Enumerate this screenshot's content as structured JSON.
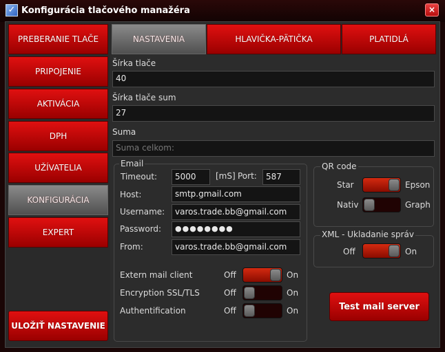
{
  "window": {
    "title": "Konfigurácia tlačového manažéra",
    "close": "×"
  },
  "sidebar": {
    "items": [
      {
        "label": "PREBERANIE TLAČE"
      },
      {
        "label": "PRIPOJENIE"
      },
      {
        "label": "AKTIVÁCIA"
      },
      {
        "label": "DPH"
      },
      {
        "label": "UŽÍVATELIA"
      },
      {
        "label": "KONFIGURÁCIA",
        "active": true
      },
      {
        "label": "EXPERT"
      }
    ],
    "save": "ULOŽIŤ NASTAVENIE"
  },
  "tabs": [
    {
      "label": "NASTAVENIA",
      "active": true
    },
    {
      "label": "HLAVIČKA-PÄTIČKA"
    },
    {
      "label": "PLATIDLÁ"
    }
  ],
  "fields": {
    "print_width_label": "Šírka tlače",
    "print_width": "40",
    "sum_width_label": "Šírka tlače sum",
    "sum_width": "27",
    "suma_label": "Suma",
    "suma_placeholder": "Suma celkom:"
  },
  "email": {
    "legend": "Email",
    "timeout_label": "Timeout:",
    "timeout": "5000",
    "unit": "[mS]",
    "port_label": "Port:",
    "port": "587",
    "host_label": "Host:",
    "host": "smtp.gmail.com",
    "username_label": "Username:",
    "username": "varos.trade.bb@gmail.com",
    "password_label": "Password:",
    "password": "●●●●●●●●",
    "from_label": "From:",
    "from": "varos.trade.bb@gmail.com",
    "toggles": [
      {
        "label": "Extern mail client",
        "off": "Off",
        "on": "On",
        "value": true
      },
      {
        "label": "Encryption SSL/TLS",
        "off": "Off",
        "on": "On",
        "value": false
      },
      {
        "label": "Authentification",
        "off": "Off",
        "on": "On",
        "value": false
      }
    ]
  },
  "qr": {
    "legend": "QR code",
    "rows": [
      {
        "left": "Star",
        "right": "Epson",
        "value": true
      },
      {
        "left": "Nativ",
        "right": "Graph",
        "value": false
      }
    ]
  },
  "xml": {
    "legend": "XML - Ukladanie správ",
    "off": "Off",
    "on": "On",
    "value": true
  },
  "test_button": "Test mail server"
}
